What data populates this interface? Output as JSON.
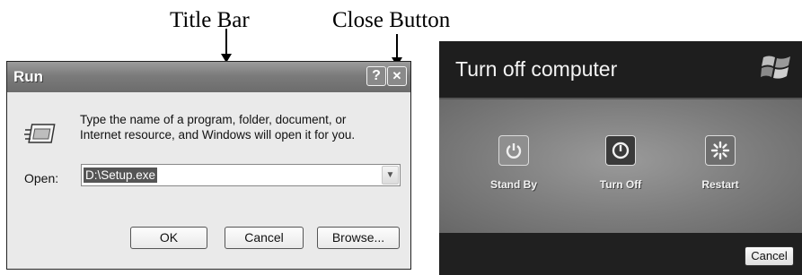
{
  "annotations": {
    "title_bar": "Title Bar",
    "close_button": "Close Button"
  },
  "run_dialog": {
    "title": "Run",
    "help_glyph": "?",
    "close_glyph": "✕",
    "description_line1": "Type the name of a program, folder, document, or",
    "description_line2": "Internet resource, and Windows will open it for you.",
    "open_label": "Open:",
    "open_value": "D:\\Setup.exe",
    "ok_label": "OK",
    "cancel_label": "Cancel",
    "browse_label": "Browse..."
  },
  "turn_off_dialog": {
    "title": "Turn off computer",
    "options": [
      {
        "label": "Stand By",
        "icon": "standby-power-icon",
        "color": "#8f8f8f"
      },
      {
        "label": "Turn Off",
        "icon": "power-icon",
        "color": "#3a3a3a"
      },
      {
        "label": "Restart",
        "icon": "restart-icon",
        "color": "#6e6e6e"
      }
    ],
    "cancel_label": "Cancel"
  }
}
